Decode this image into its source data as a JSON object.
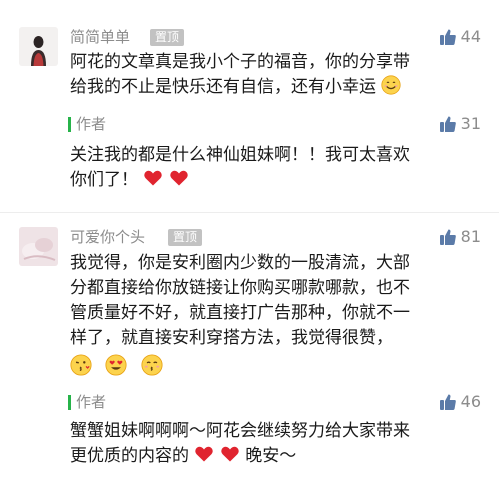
{
  "comments": [
    {
      "username": "简简单单",
      "pin_badge": "置顶",
      "likes": "44",
      "text_line1": "阿花的文章真是我小个子的福音，你的分享带",
      "text_line2": "给我的不止是快乐还有自信，还有小幸运",
      "reply": {
        "author_label": "作者",
        "likes": "31",
        "text_line1": "关注我的都是什么神仙姐妹啊！！我可太喜欢",
        "text_line2": "你们了！"
      }
    },
    {
      "username": "可爱你个头",
      "pin_badge": "置顶",
      "likes": "81",
      "text_line1": "我觉得，你是安利圈内少数的一股清流，大部",
      "text_line2": "分都直接给你放链接让你购买哪款哪款，也不",
      "text_line3": "管质量好不好，就直接打广告那种，你就不一",
      "text_line4": "样了，就直接安利穿搭方法，我觉得很赞，",
      "reply": {
        "author_label": "作者",
        "likes": "46",
        "text_line1": "蟹蟹姐妹啊啊啊～阿花会继续努力给大家带来",
        "text_line2": "更优质的内容的",
        "text_line2_end": "晚安～"
      }
    }
  ],
  "colors": {
    "author_bar": "#27b34a",
    "heart": "#e0242f",
    "meta": "#8c8c8c"
  }
}
